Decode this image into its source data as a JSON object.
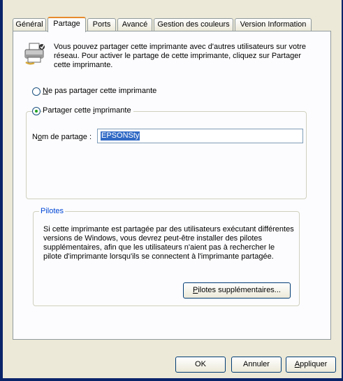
{
  "tabs": [
    {
      "label": "Général"
    },
    {
      "label": "Partage"
    },
    {
      "label": "Ports"
    },
    {
      "label": "Avancé"
    },
    {
      "label": "Gestion des couleurs"
    },
    {
      "label": "Version Information"
    }
  ],
  "active_tab": "Partage",
  "intro_text": "Vous pouvez partager cette imprimante avec d'autres utilisateurs sur votre réseau. Pour activer le partage de cette imprimante, cliquez sur Partager cette imprimante.",
  "sharing": {
    "no_share": {
      "mnemonic": "N",
      "rest": "e pas partager cette imprimante"
    },
    "share": {
      "before": "Partager cette ",
      "mnemonic": "i",
      "after": "mprimante"
    },
    "selected": "share",
    "share_name_label": {
      "before": "N",
      "mnemonic": "o",
      "after": "m de partage :"
    },
    "share_name_value": "EPSONSty"
  },
  "drivers": {
    "title": "Pilotes",
    "text": "Si cette imprimante est partagée par des utilisateurs exécutant différentes versions de Windows, vous devrez peut-être installer des pilotes supplémentaires, afin que les utilisateurs n'aient pas à rechercher le pilote d'imprimante lorsqu'ils se connectent à l'imprimante partagée.",
    "button": {
      "mnemonic": "P",
      "rest": "ilotes supplémentaires..."
    }
  },
  "footer": {
    "ok": "OK",
    "cancel": "Annuler",
    "apply": {
      "mnemonic": "A",
      "rest": "ppliquer"
    }
  }
}
